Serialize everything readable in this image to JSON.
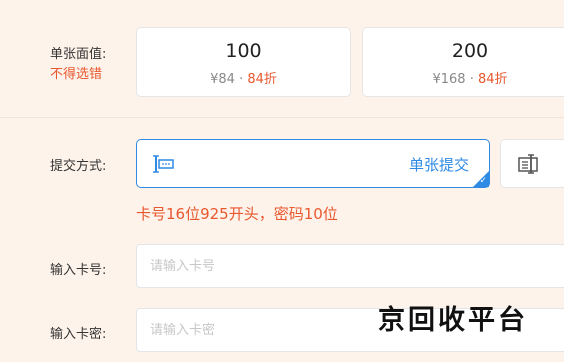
{
  "face_value": {
    "label": "单张面值:",
    "warning": "不得选错",
    "options": [
      {
        "value": "100",
        "price": "¥84",
        "separator": "·",
        "discount": "84折"
      },
      {
        "value": "200",
        "price": "¥168",
        "separator": "·",
        "discount": "84折"
      }
    ]
  },
  "submit_method": {
    "label": "提交方式:",
    "options": [
      {
        "label": "单张提交",
        "icon": "single-card-icon",
        "selected": true
      },
      {
        "label": "",
        "icon": "batch-card-icon",
        "selected": false
      }
    ],
    "hint": "卡号16位925开头，密码10位"
  },
  "card_number": {
    "label": "输入卡号:",
    "placeholder": "请输入卡号",
    "value": ""
  },
  "card_password": {
    "label": "输入卡密:",
    "placeholder": "请输入卡密",
    "value": ""
  },
  "watermark": "京回收平台",
  "colors": {
    "accent": "#2f8ae4",
    "warning": "#e8572e",
    "background": "#fdf3ea"
  }
}
